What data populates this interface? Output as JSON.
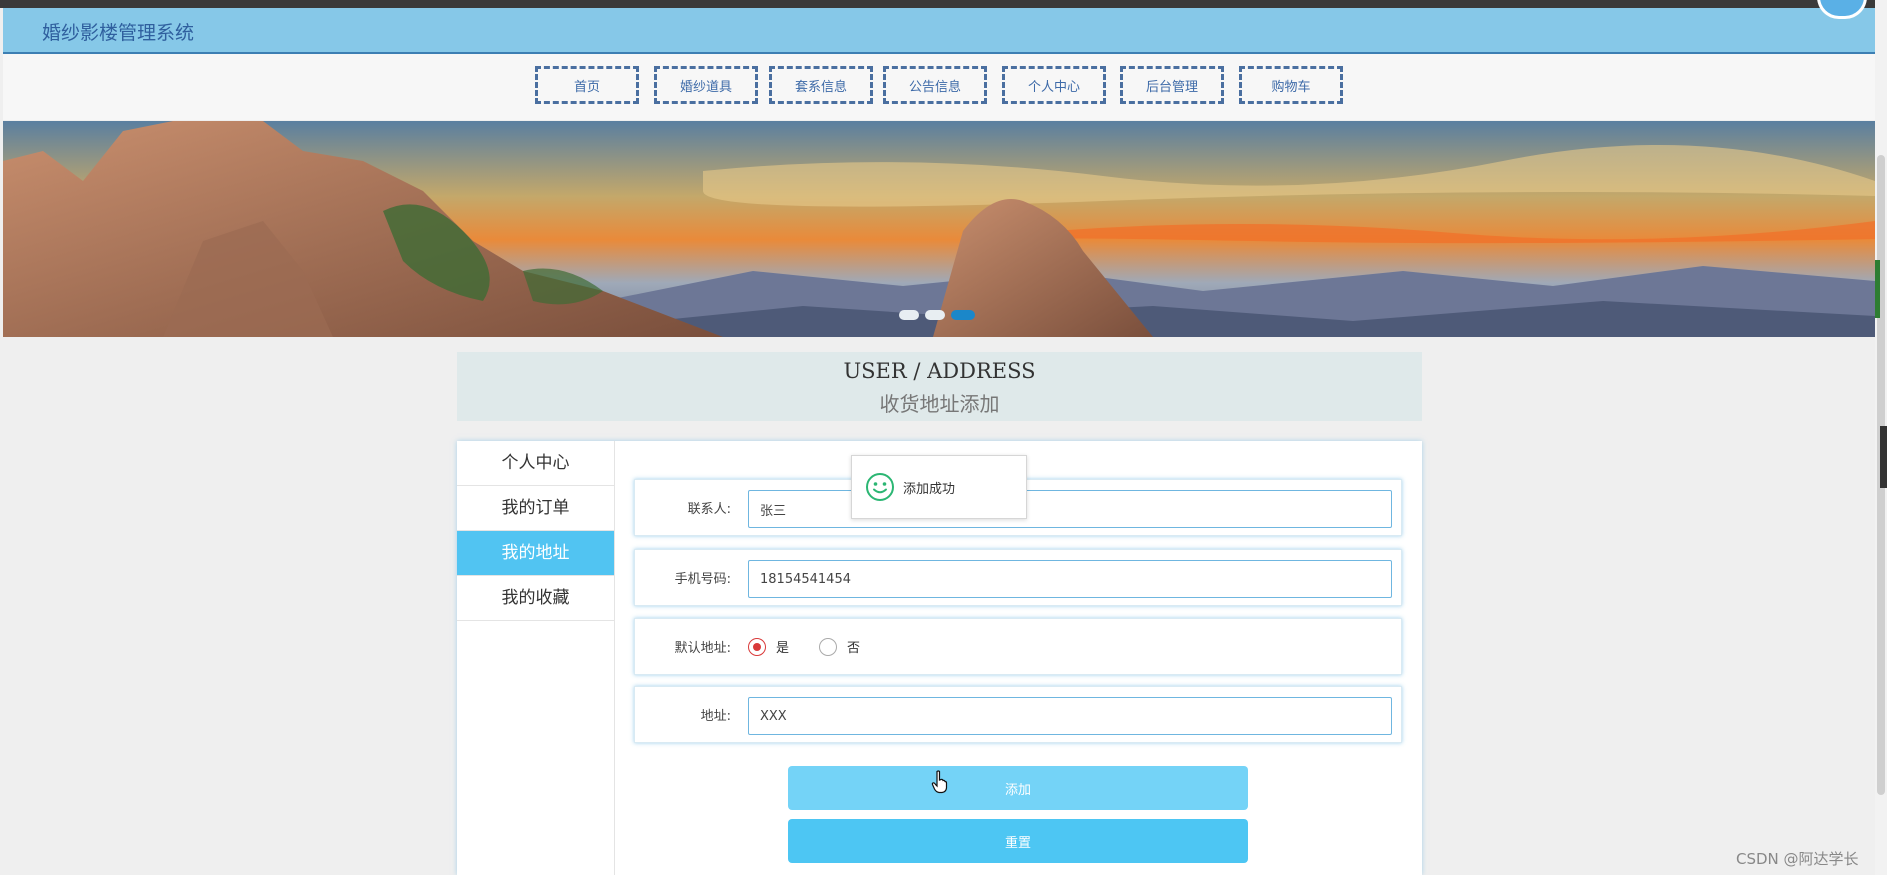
{
  "app": {
    "title": "婚纱影楼管理系统"
  },
  "nav": {
    "items": [
      {
        "label": "首页"
      },
      {
        "label": "婚纱道具"
      },
      {
        "label": "套系信息"
      },
      {
        "label": "公告信息"
      },
      {
        "label": "个人中心"
      },
      {
        "label": "后台管理"
      },
      {
        "label": "购物车"
      }
    ]
  },
  "banner": {
    "slides": 3,
    "active_slide": 3
  },
  "section": {
    "title_en": "USER / ADDRESS",
    "title_cn": "收货地址添加"
  },
  "sidebar": {
    "items": [
      {
        "label": "个人中心",
        "active": false
      },
      {
        "label": "我的订单",
        "active": false
      },
      {
        "label": "我的地址",
        "active": true
      },
      {
        "label": "我的收藏",
        "active": false
      }
    ]
  },
  "form": {
    "contact_label": "联系人:",
    "contact_value": "张三",
    "phone_label": "手机号码:",
    "phone_value": "18154541454",
    "default_label": "默认地址:",
    "default_yes": "是",
    "default_no": "否",
    "default_selected": "是",
    "address_label": "地址:",
    "address_value": "XXX",
    "add_button": "添加",
    "reset_button": "重置"
  },
  "toast": {
    "icon": "smile-icon",
    "message": "添加成功"
  },
  "watermark": "CSDN @阿达学长",
  "colors": {
    "topbar": "#86c8e8",
    "accent": "#51c4f2",
    "add_button": "#74d3f7",
    "reset_button": "#4dc6f3",
    "radio_checked": "#d93a3a",
    "nav_border": "#4a6fa0"
  }
}
